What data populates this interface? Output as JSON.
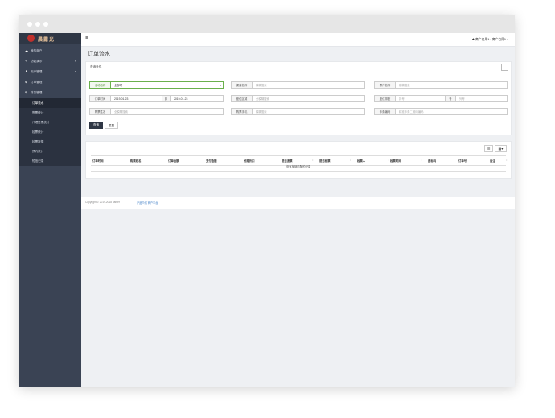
{
  "sidebar": {
    "logo_text": "晨露光",
    "items": [
      {
        "label": "我的商户",
        "icon": "☁",
        "arrow": ""
      },
      {
        "label": "功能演示",
        "icon": "✎",
        "arrow": "‹"
      },
      {
        "label": "用户管理",
        "icon": "♟",
        "arrow": "‹"
      },
      {
        "label": "订单管理",
        "icon": "$",
        "arrow": ""
      },
      {
        "label": "财务管理",
        "icon": "$",
        "arrow": ""
      }
    ],
    "sub_items": [
      {
        "label": "订单流水"
      },
      {
        "label": "售票统计"
      },
      {
        "label": "代理售票统计"
      },
      {
        "label": "检票统计"
      },
      {
        "label": "检票数据"
      },
      {
        "label": "预约统计"
      },
      {
        "label": "短信记录"
      }
    ]
  },
  "topbar": {
    "menu_icon": "≡",
    "user_text": "♟ 商户名用1 - 商户名用1 ▾"
  },
  "page": {
    "title": "订单流水"
  },
  "query": {
    "title": "查询条件",
    "collapse_symbol": "⌄",
    "fields": {
      "activity_label": "活动名称",
      "activity_value": "全部项",
      "channel_label": "渠道名称",
      "channel_placeholder": "模糊搜索",
      "product_label": "票付名称",
      "product_placeholder": "模糊搜索",
      "time_label": "订单时间",
      "time_start": "2019-01-23",
      "time_sep": "到",
      "time_end": "2019-01-23",
      "area_label": "座位区域",
      "area_placeholder": "全模糊搜索",
      "seat_label": "座位排座",
      "seat_row_placeholder": "排号",
      "seat_sep": "号",
      "seat_col_placeholder": "列号",
      "buyer_label": "购票姓名",
      "buyer_placeholder": "全模糊搜索",
      "phone_label": "购票手机",
      "phone_placeholder": "模糊搜索",
      "code_label": "卡券编码",
      "code_placeholder": "精准卡券二维码编码"
    },
    "search_button": "查询",
    "reset_button": "重置"
  },
  "table": {
    "columns": [
      "订单时间",
      "购票姓名",
      "订单金额",
      "支付金额",
      "代理折扣",
      "是否退票",
      "是否检票",
      "检票人",
      "检票时间",
      "座标码",
      "订单号",
      "备注"
    ],
    "empty_text": "没有找到匹配的记录",
    "toolbar_icons": [
      "list-icon",
      "columns-icon"
    ]
  },
  "footer": {
    "copyright": "Copyright © 2019-2018 parker",
    "link_text": "产品介绍 商户平台"
  }
}
